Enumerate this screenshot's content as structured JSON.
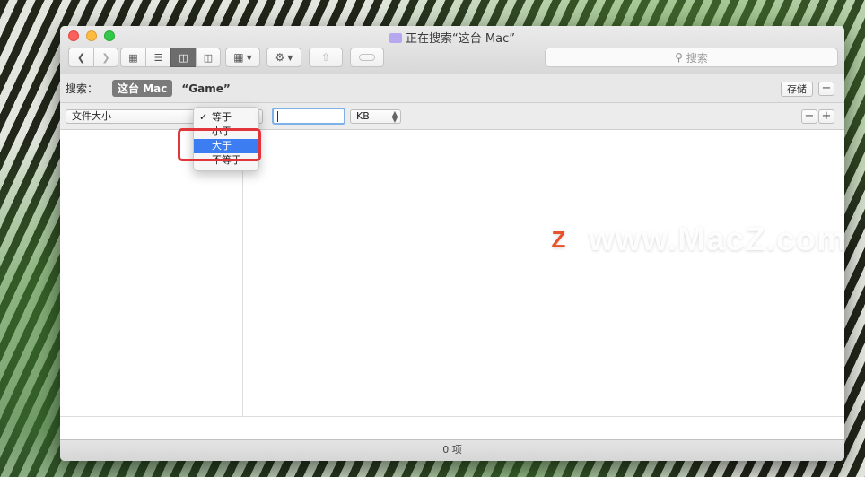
{
  "window": {
    "title": "正在搜索“这台 Mac”"
  },
  "toolbar": {
    "back_icon": "chevron-left",
    "forward_icon": "chevron-right",
    "view_icons": [
      "icon-view",
      "list-view",
      "column-view",
      "gallery-view"
    ],
    "search_placeholder": "搜索"
  },
  "scopebar": {
    "label": "搜索：",
    "scope_selected": "这台 Mac",
    "scope_other": "“Game”",
    "save_label": "存储",
    "remove_label": "−"
  },
  "criteria": {
    "attribute": "文件大小",
    "operator": "等于",
    "value": "",
    "unit": "KB",
    "remove_label": "−",
    "add_label": "+"
  },
  "operator_menu": {
    "items": [
      "等于",
      "小于",
      "大于",
      "不等于"
    ],
    "checked": "等于",
    "highlighted": "大于"
  },
  "status": {
    "count": "0 项"
  },
  "watermark": {
    "logo": "Z",
    "text": "www.MacZ.com"
  },
  "colors": {
    "highlight_red": "#e0353a",
    "menu_selection": "#3c7ef1"
  }
}
